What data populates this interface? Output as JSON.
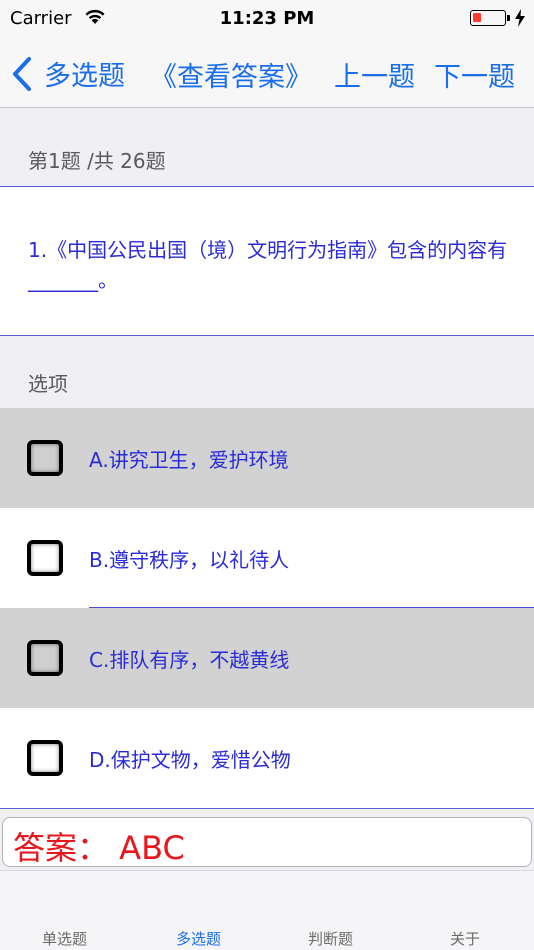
{
  "status_bar": {
    "carrier": "Carrier",
    "time": "11:23 PM",
    "battery_level": 0.25,
    "battery_color": "#ff3b30"
  },
  "nav": {
    "back_label": "多选题",
    "answer_label": "《查看答案》",
    "prev_label": "上一题",
    "next_label": "下一题",
    "accent_color": "#1a6eea"
  },
  "counter": "第1题 /共 26题",
  "question": "1.《中国公民出国（境）文明行为指南》包含的内容有_______。",
  "options_header": "选项",
  "options": [
    {
      "label": "A.讲究卫生，爱护环境",
      "checked": false
    },
    {
      "label": "B.遵守秩序，以礼待人",
      "checked": false
    },
    {
      "label": "C.排队有序，不越黄线",
      "checked": false
    },
    {
      "label": "D.保护文物，爱惜公物",
      "checked": false
    }
  ],
  "answer": "答案： ABC",
  "answer_color": "#e8171e",
  "tabs": [
    {
      "label": "单选题",
      "active": false
    },
    {
      "label": "多选题",
      "active": true
    },
    {
      "label": "判断题",
      "active": false
    },
    {
      "label": "关于",
      "active": false
    }
  ]
}
